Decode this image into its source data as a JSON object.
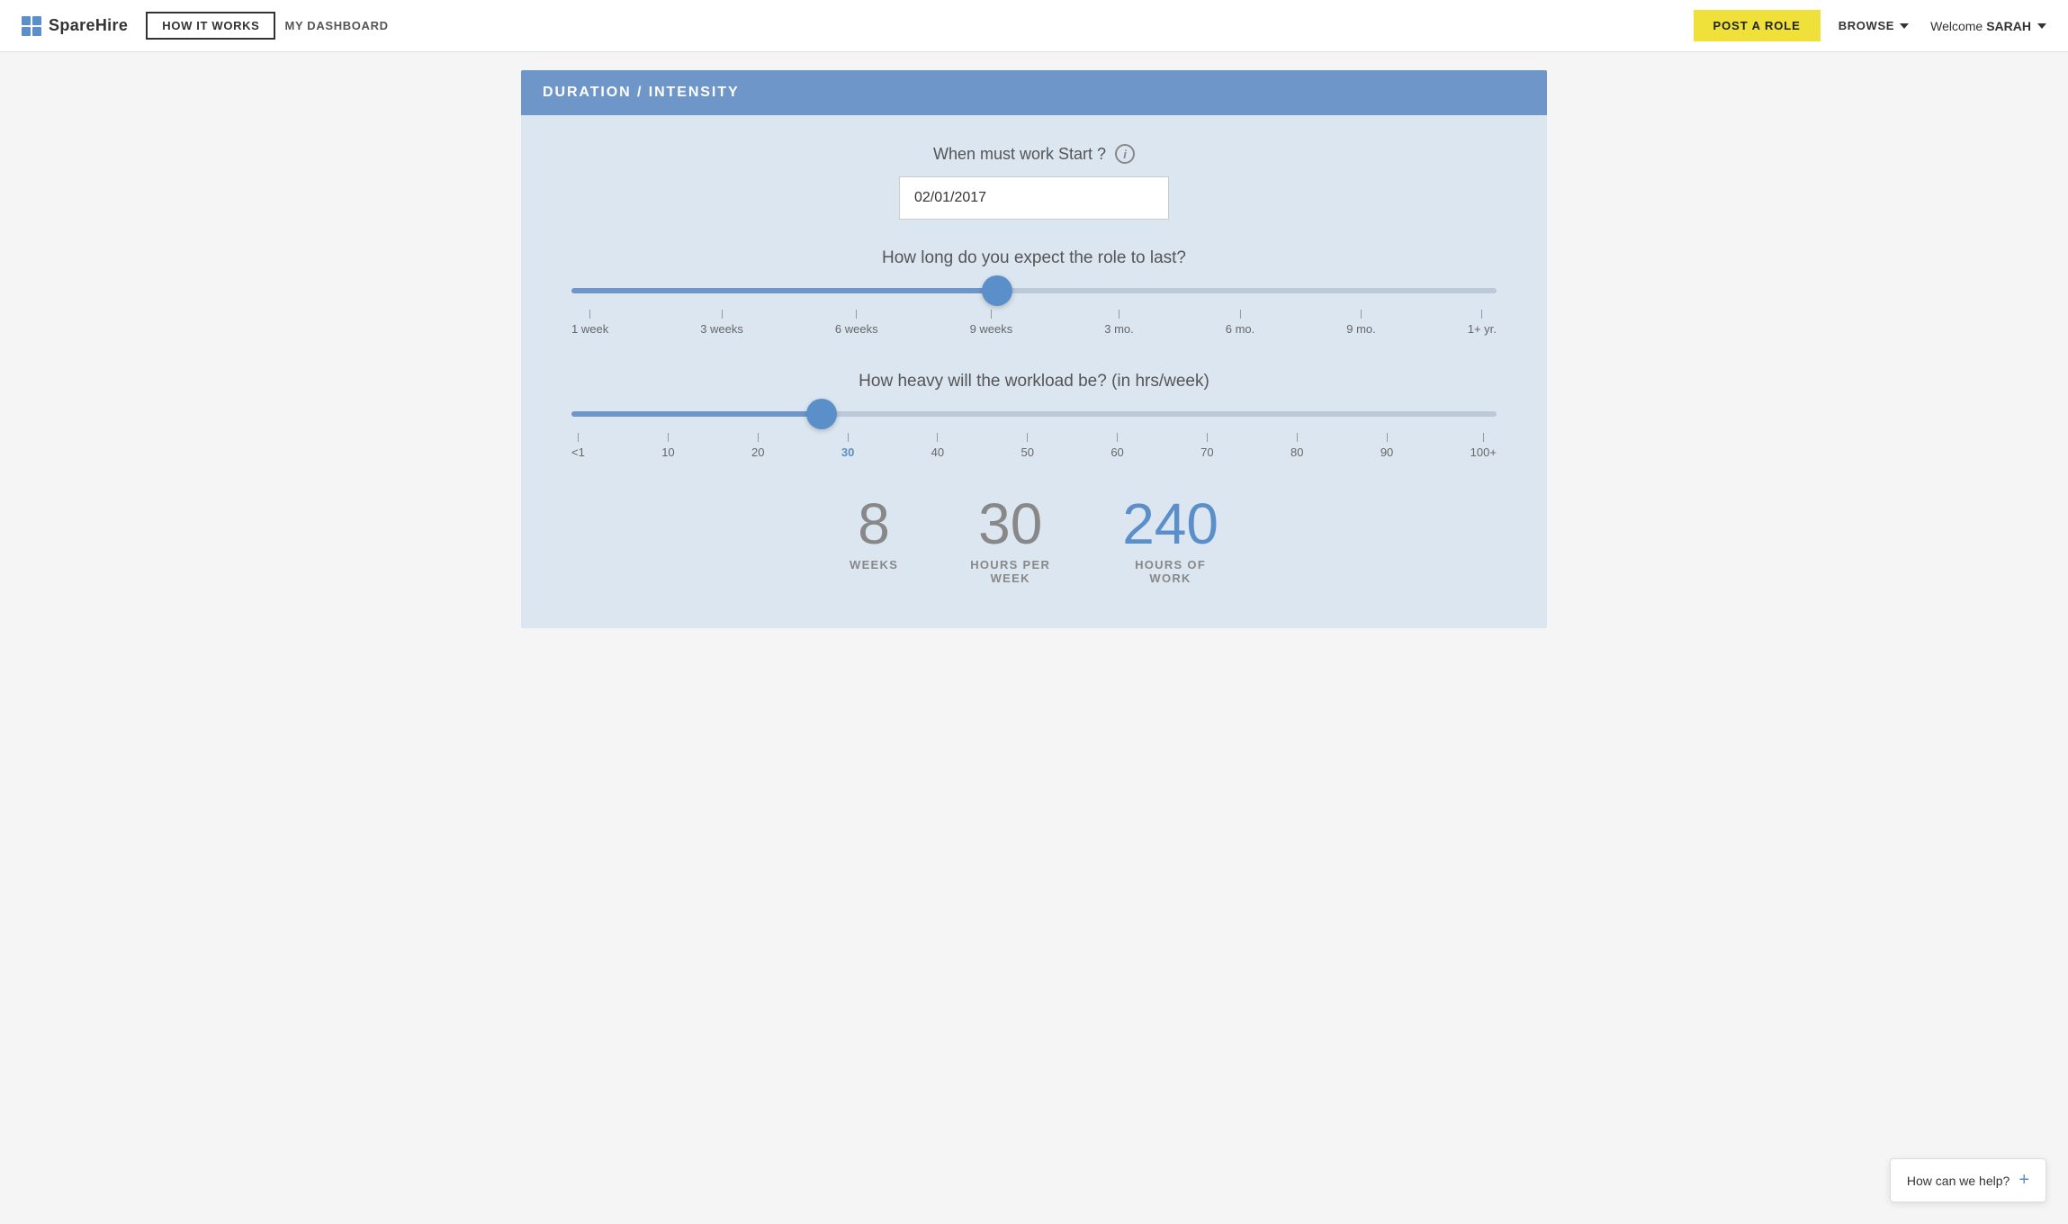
{
  "navbar": {
    "logo_text": "SpareHire",
    "how_it_works_label": "HOW IT WORKS",
    "my_dashboard_label": "MY DASHBOARD",
    "post_role_label": "POST A ROLE",
    "browse_label": "BROWSE",
    "welcome_prefix": "Welcome",
    "user_name": "SARAH"
  },
  "section": {
    "title": "DURATION / INTENSITY",
    "start_date_label": "When must work Start ?",
    "start_date_value": "02/01/2017",
    "start_date_placeholder": "02/01/2017",
    "duration_label": "How long do you expect the role to last?",
    "workload_label": "How heavy will the workload be? (in hrs/week)",
    "duration_ticks": [
      {
        "label": "1 week"
      },
      {
        "label": "3 weeks"
      },
      {
        "label": "6 weeks"
      },
      {
        "label": "9 weeks"
      },
      {
        "label": "3 mo."
      },
      {
        "label": "6 mo."
      },
      {
        "label": "9 mo."
      },
      {
        "label": "1+ yr."
      }
    ],
    "duration_thumb_pct": 46,
    "workload_ticks": [
      {
        "label": "<1",
        "highlighted": false
      },
      {
        "label": "10",
        "highlighted": false
      },
      {
        "label": "20",
        "highlighted": false
      },
      {
        "label": "30",
        "highlighted": true
      },
      {
        "label": "40",
        "highlighted": false
      },
      {
        "label": "50",
        "highlighted": false
      },
      {
        "label": "60",
        "highlighted": false
      },
      {
        "label": "70",
        "highlighted": false
      },
      {
        "label": "80",
        "highlighted": false
      },
      {
        "label": "90",
        "highlighted": false
      },
      {
        "label": "100+",
        "highlighted": false
      }
    ],
    "workload_thumb_pct": 27,
    "summary": {
      "weeks_value": "8",
      "weeks_unit": "WEEKS",
      "hours_per_week_value": "30",
      "hours_per_week_unit": "HOURS PER\nWEEK",
      "hours_of_work_value": "240",
      "hours_of_work_unit": "HOURS OF\nWORK"
    }
  },
  "help": {
    "label": "How can we help?",
    "icon": "+"
  }
}
